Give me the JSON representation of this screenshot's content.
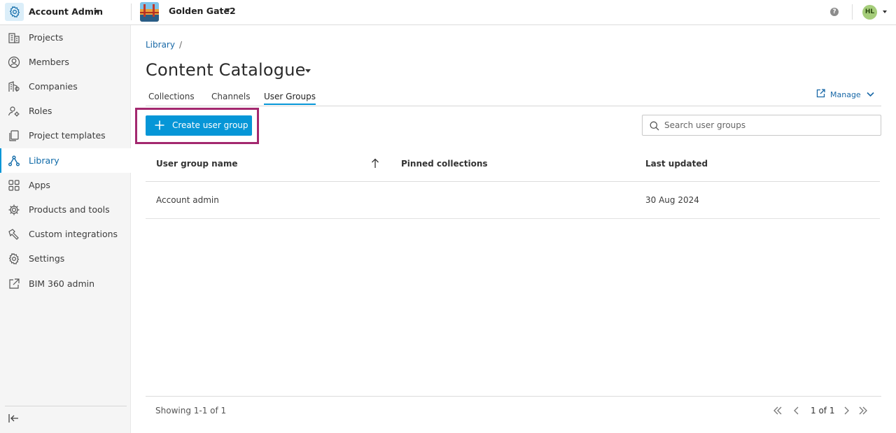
{
  "header": {
    "app_title": "Account Admin",
    "project_name": "Golden Gate2",
    "help_label": "?",
    "avatar_initials": "HL"
  },
  "sidebar": {
    "items": [
      {
        "label": "Projects",
        "icon": "building-icon"
      },
      {
        "label": "Members",
        "icon": "user-circle-icon"
      },
      {
        "label": "Companies",
        "icon": "company-icon"
      },
      {
        "label": "Roles",
        "icon": "user-gear-icon"
      },
      {
        "label": "Project templates",
        "icon": "template-icon"
      },
      {
        "label": "Library",
        "icon": "library-icon",
        "active": true
      },
      {
        "label": "Apps",
        "icon": "apps-grid-icon"
      },
      {
        "label": "Products and tools",
        "icon": "gear-cog-icon"
      },
      {
        "label": "Custom integrations",
        "icon": "hammer-icon"
      },
      {
        "label": "Settings",
        "icon": "gear-icon"
      },
      {
        "label": "BIM 360 admin",
        "icon": "external-link-icon"
      }
    ]
  },
  "breadcrumb": {
    "items": [
      "Library"
    ],
    "separator": "/"
  },
  "page": {
    "title": "Content Catalogue"
  },
  "tabs": [
    {
      "label": "Collections"
    },
    {
      "label": "Channels"
    },
    {
      "label": "User Groups",
      "active": true
    }
  ],
  "manage": {
    "label": "Manage"
  },
  "toolbar": {
    "create_label": "Create user group"
  },
  "search": {
    "placeholder": "Search user groups",
    "value": ""
  },
  "table": {
    "columns": [
      "User group name",
      "Pinned collections",
      "Last updated"
    ],
    "rows": [
      {
        "name": "Account admin",
        "pinned": "",
        "updated": "30 Aug 2024"
      }
    ]
  },
  "footer": {
    "showing": "Showing 1-1 of 1",
    "page_indicator": "1 of 1"
  },
  "colors": {
    "accent": "#0696d7",
    "link": "#1868a7",
    "highlight": "#a3286f",
    "avatar": "#a5cd7a"
  }
}
